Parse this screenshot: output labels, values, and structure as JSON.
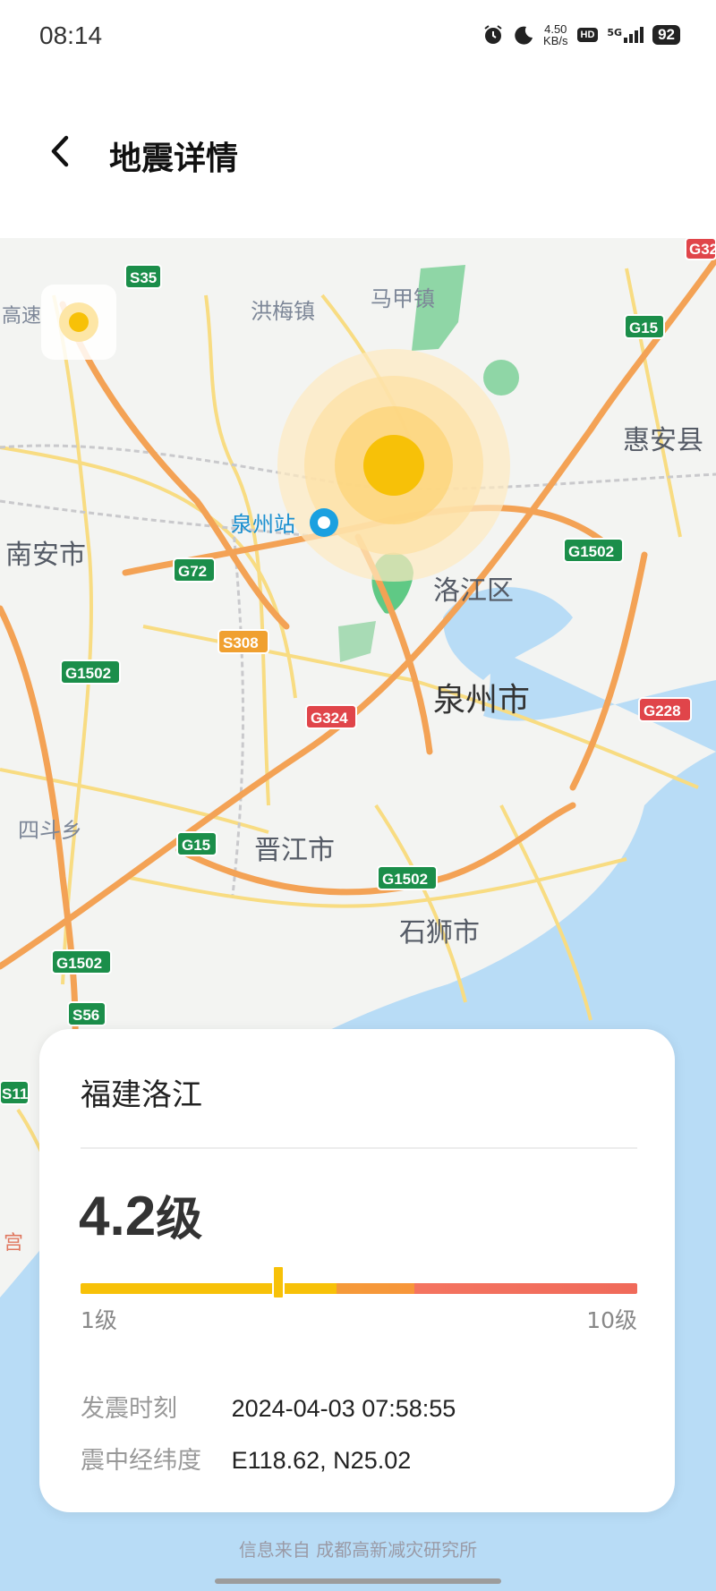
{
  "status_bar": {
    "time": "08:14",
    "speed_value": "4.50",
    "speed_unit": "KB/s",
    "hd_badge": "HD",
    "network": "5G",
    "battery": "92",
    "icons": [
      "alarm-icon",
      "moon-icon",
      "hd-icon",
      "signal-icon",
      "battery-icon"
    ]
  },
  "header": {
    "title": "地震详情",
    "back_icon": "chevron-left-icon"
  },
  "map": {
    "place_labels": [
      "洪梅镇",
      "马甲镇",
      "惠安县",
      "南安市",
      "洛江区",
      "泉州市",
      "四斗乡",
      "晋江市",
      "石狮市",
      "泉州站",
      "高速",
      "宫"
    ],
    "road_shields": [
      "S35",
      "G15",
      "G32",
      "G72",
      "G1502",
      "S308",
      "G1502",
      "G324",
      "G228",
      "G15",
      "G1502",
      "G1502",
      "S56",
      "S11"
    ],
    "epicenter_color": "#f7c108",
    "sea_color": "#b8dcf6",
    "green_color": "#8fd6a6"
  },
  "card": {
    "location": "福建洛江",
    "magnitude": "4.2",
    "magnitude_unit": "级",
    "scale_min": "1级",
    "scale_max": "10级",
    "scale_range": [
      1,
      10
    ],
    "magnitude_value": 4.2,
    "time_label": "发震时刻",
    "time_value": "2024-04-03 07:58:55",
    "coord_label": "震中经纬度",
    "coord_value": "E118.62, N25.02"
  },
  "footer": {
    "source": "信息来自 成都高新减灾研究所"
  }
}
